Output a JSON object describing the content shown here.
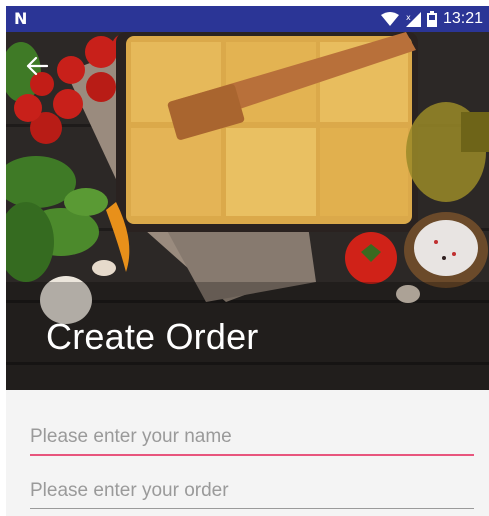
{
  "status_bar": {
    "app_glyph": "N",
    "time": "13:21",
    "icons": [
      "wifi-icon",
      "signal-no-data-icon",
      "battery-icon"
    ]
  },
  "header": {
    "back_icon": "arrow-left-icon",
    "title": "Create Order",
    "hero_image": "lasagna-food-photo"
  },
  "form": {
    "name_placeholder": "Please enter your name",
    "order_placeholder": "Please enter your order"
  },
  "colors": {
    "status_bar": "#2b3596",
    "accent": "#e8557d",
    "placeholder": "#9a9a9a",
    "background": "#f4f4f4"
  }
}
